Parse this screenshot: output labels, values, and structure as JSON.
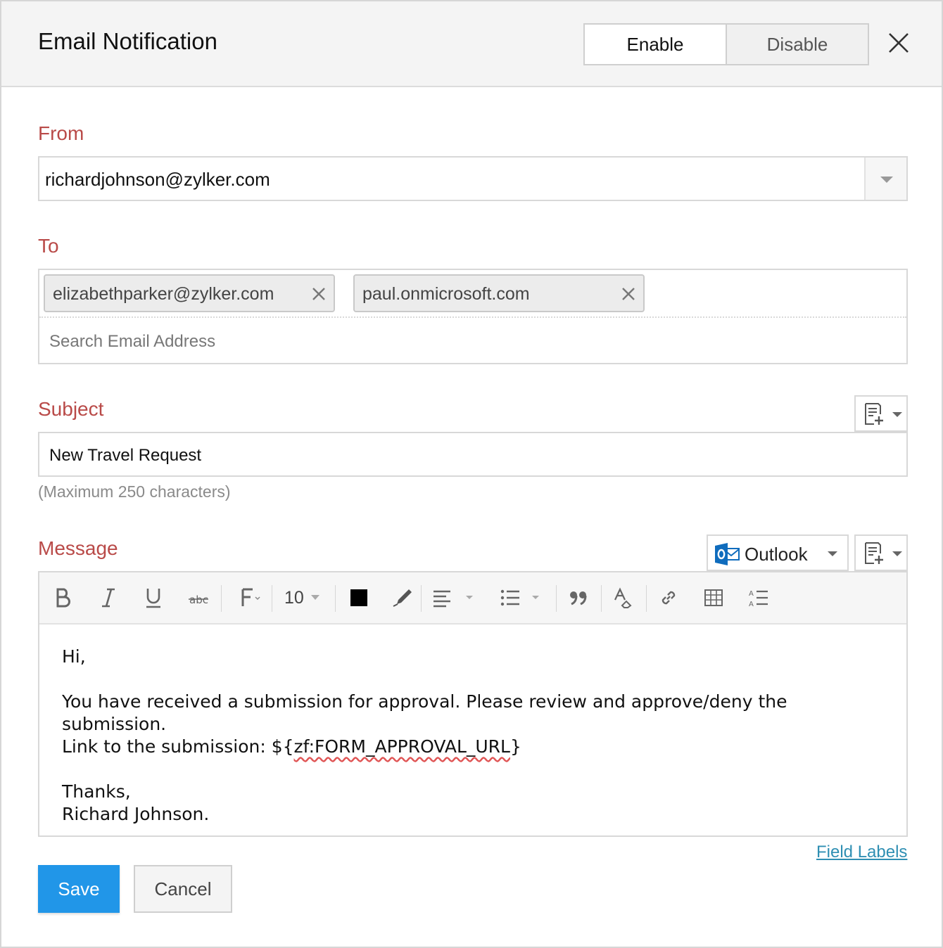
{
  "dialog": {
    "title": "Email Notification",
    "toggle": {
      "enable_label": "Enable",
      "disable_label": "Disable",
      "selected": "Enable"
    },
    "close_icon": "close-icon"
  },
  "from": {
    "label": "From",
    "value": "richardjohnson@zylker.com"
  },
  "to": {
    "label": "To",
    "recipients": [
      {
        "email": "elizabethparker@zylker.com"
      },
      {
        "email": "paul.onmicrosoft.com"
      }
    ],
    "search_placeholder": "Search Email Address"
  },
  "subject": {
    "label": "Subject",
    "value": "New Travel Request",
    "hint": "(Maximum 250 characters)"
  },
  "message": {
    "label": "Message",
    "template_selector": "Outlook",
    "toolbar": {
      "font_size": "10",
      "text_color": "#000000",
      "icons": [
        "bold-icon",
        "italic-icon",
        "underline-icon",
        "strikethrough-icon",
        "font-family-icon",
        "text-color-icon",
        "highlight-icon",
        "align-icon",
        "list-icon",
        "quote-icon",
        "clear-format-icon",
        "link-icon",
        "table-icon",
        "line-spacing-icon"
      ]
    },
    "body_lines": [
      "Hi,",
      "",
      "You have received a submission for approval. Please review and approve/deny the submission.",
      "Link to the submission: ${zf:FORM_APPROVAL_URL}",
      "",
      "Thanks,",
      "Richard Johnson."
    ]
  },
  "field_labels_link": "Field Labels",
  "actions": {
    "save_label": "Save",
    "cancel_label": "Cancel"
  },
  "colors": {
    "accent": "#2196e8",
    "label": "#b94a48",
    "link": "#2f8fb3",
    "outlook": "#0f6cbd"
  }
}
